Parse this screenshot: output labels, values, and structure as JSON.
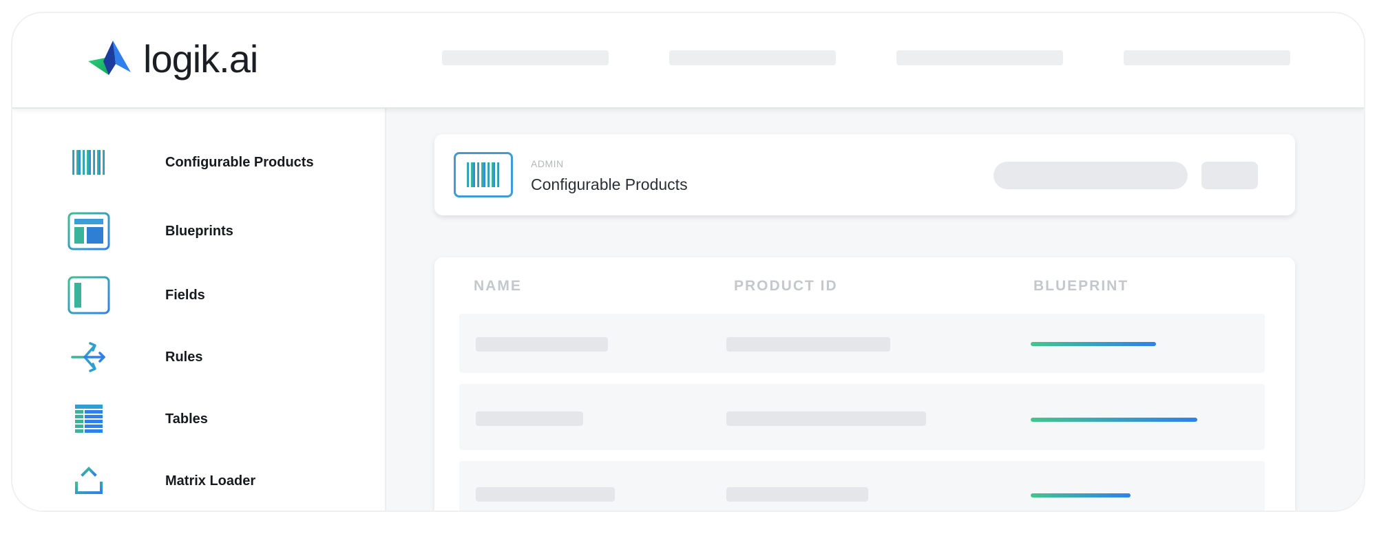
{
  "brand": {
    "name": "logik.ai",
    "colors": {
      "green": "#27b46a",
      "blue": "#2f80ed",
      "navy": "#1c3d9e"
    }
  },
  "sidebar": {
    "items": [
      {
        "label": "Configurable Products",
        "icon": "barcode-icon"
      },
      {
        "label": "Blueprints",
        "icon": "blueprint-icon"
      },
      {
        "label": "Fields",
        "icon": "field-icon"
      },
      {
        "label": "Rules",
        "icon": "rules-arrows-icon"
      },
      {
        "label": "Tables",
        "icon": "table-icon"
      },
      {
        "label": "Matrix Loader",
        "icon": "upload-icon"
      }
    ]
  },
  "header": {
    "eyebrow": "ADMIN",
    "title": "Configurable Products",
    "icon": "barcode-icon"
  },
  "table": {
    "columns": [
      "NAME",
      "PRODUCT ID",
      "BLUEPRINT"
    ],
    "rows": [
      {
        "blueprint_fill": 0.75
      },
      {
        "blueprint_fill": 1.0
      },
      {
        "blueprint_fill": 0.6
      }
    ]
  }
}
